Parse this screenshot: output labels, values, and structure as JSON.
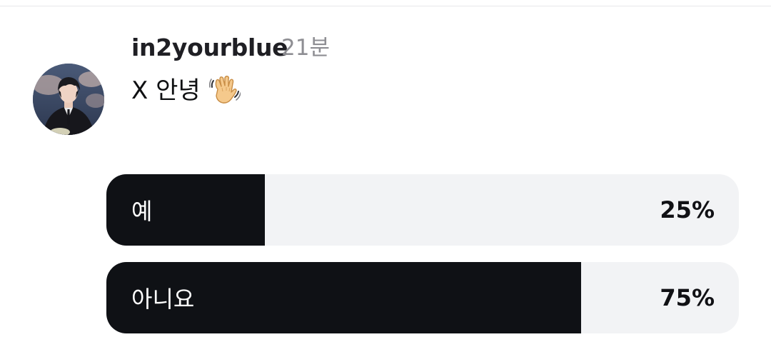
{
  "post": {
    "username": "in2yourblue",
    "time": "21분",
    "text": "X 안녕",
    "emoji_icon": "waving-hand-icon"
  },
  "poll": {
    "options": [
      {
        "label": "예",
        "percent_text": "25%",
        "percent": 25
      },
      {
        "label": "아니요",
        "percent_text": "75%",
        "percent": 75
      }
    ]
  },
  "colors": {
    "fill": "#0f1115",
    "track": "#f2f3f5",
    "username": "#1f1f24",
    "time": "#8e8e93"
  }
}
